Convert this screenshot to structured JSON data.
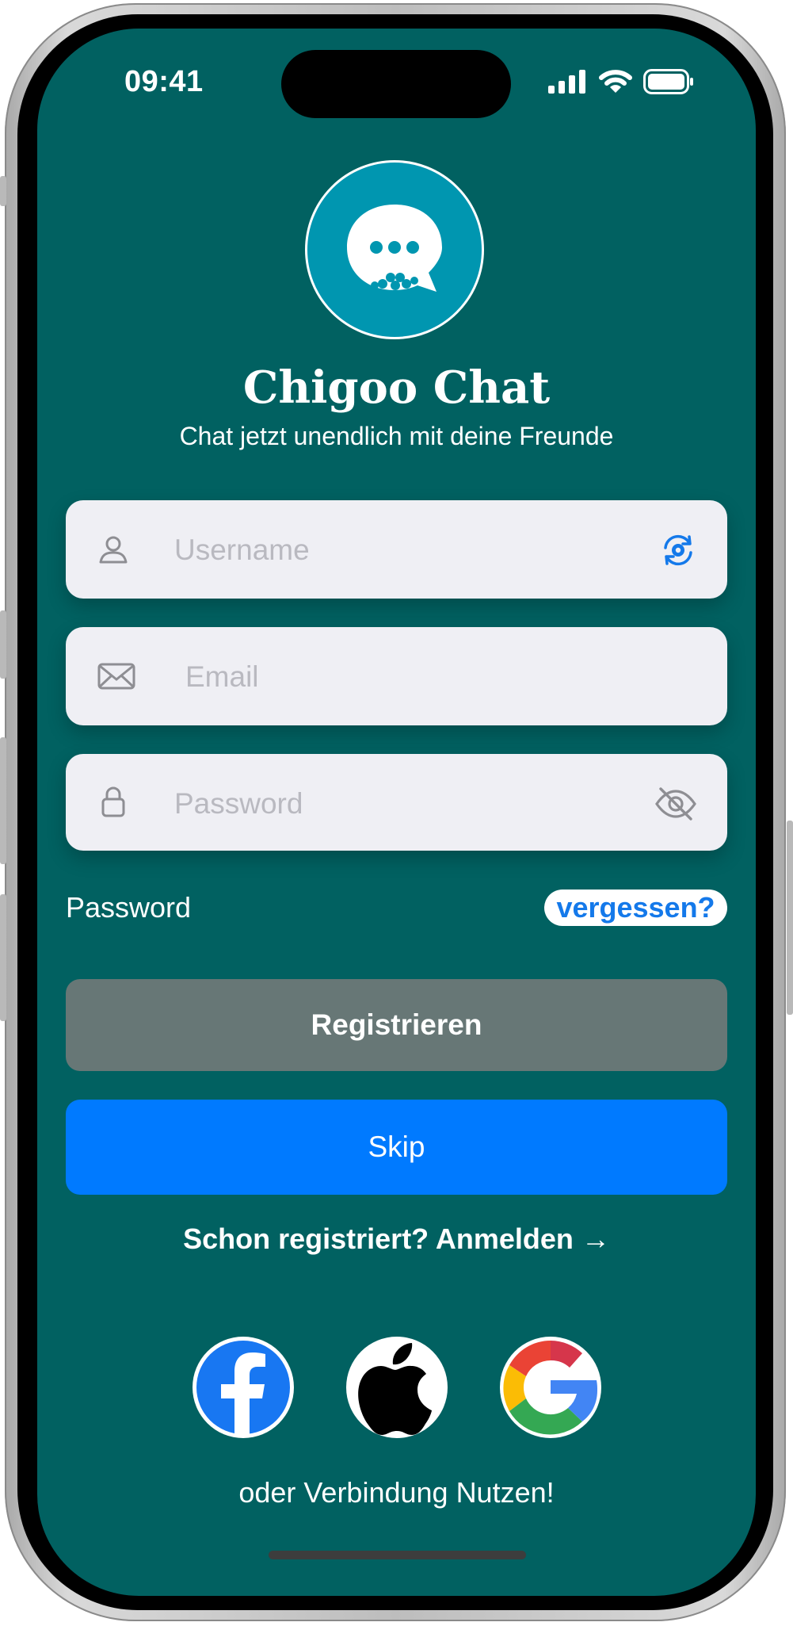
{
  "status_bar": {
    "time": "09:41"
  },
  "app": {
    "title": "Chigoo Chat",
    "subtitle": "Chat jetzt unendlich mit deine Freunde"
  },
  "form": {
    "username": {
      "placeholder": "Username",
      "value": ""
    },
    "email": {
      "placeholder": "Email",
      "value": ""
    },
    "password": {
      "placeholder": "Password",
      "value": ""
    },
    "password_label": "Password",
    "forgot_label": "vergessen?",
    "register_label": "Registrieren",
    "skip_label": "Skip",
    "signin_link": "Schon registriert? Anmelden →"
  },
  "social": {
    "providers": [
      "facebook",
      "apple",
      "google"
    ],
    "caption": "oder Verbindung Nutzen!"
  },
  "colors": {
    "background": "#016161",
    "accent": "#007aff",
    "register_button": "#677776",
    "logo_circle": "#0096b0"
  }
}
